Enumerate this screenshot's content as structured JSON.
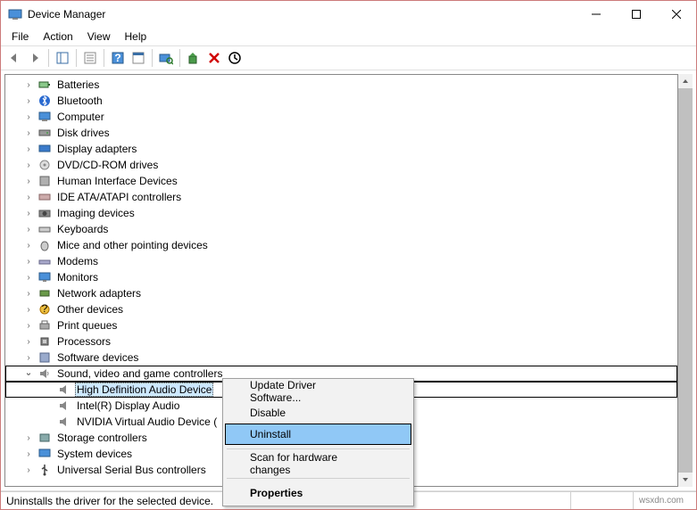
{
  "title": "Device Manager",
  "menu": {
    "file": "File",
    "action": "Action",
    "view": "View",
    "help": "Help"
  },
  "tree": {
    "batteries": "Batteries",
    "bluetooth": "Bluetooth",
    "computer": "Computer",
    "diskdrives": "Disk drives",
    "displayadapters": "Display adapters",
    "dvdcd": "DVD/CD-ROM drives",
    "hid": "Human Interface Devices",
    "ide": "IDE ATA/ATAPI controllers",
    "imaging": "Imaging devices",
    "keyboards": "Keyboards",
    "mice": "Mice and other pointing devices",
    "modems": "Modems",
    "monitors": "Monitors",
    "netadapters": "Network adapters",
    "otherdev": "Other devices",
    "printqueues": "Print queues",
    "processors": "Processors",
    "softdev": "Software devices",
    "soundvideo": "Sound, video and game controllers",
    "hdaudio": "High Definition Audio Device",
    "inteldisp": "Intel(R) Display Audio",
    "nvidia": "NVIDIA Virtual Audio Device (",
    "storage": "Storage controllers",
    "sysdev": "System devices",
    "usb": "Universal Serial Bus controllers"
  },
  "ctx": {
    "update": "Update Driver Software...",
    "disable": "Disable",
    "uninstall": "Uninstall",
    "scan": "Scan for hardware changes",
    "properties": "Properties"
  },
  "status": "Uninstalls the driver for the selected device.",
  "watermark": "wsxdn.com"
}
